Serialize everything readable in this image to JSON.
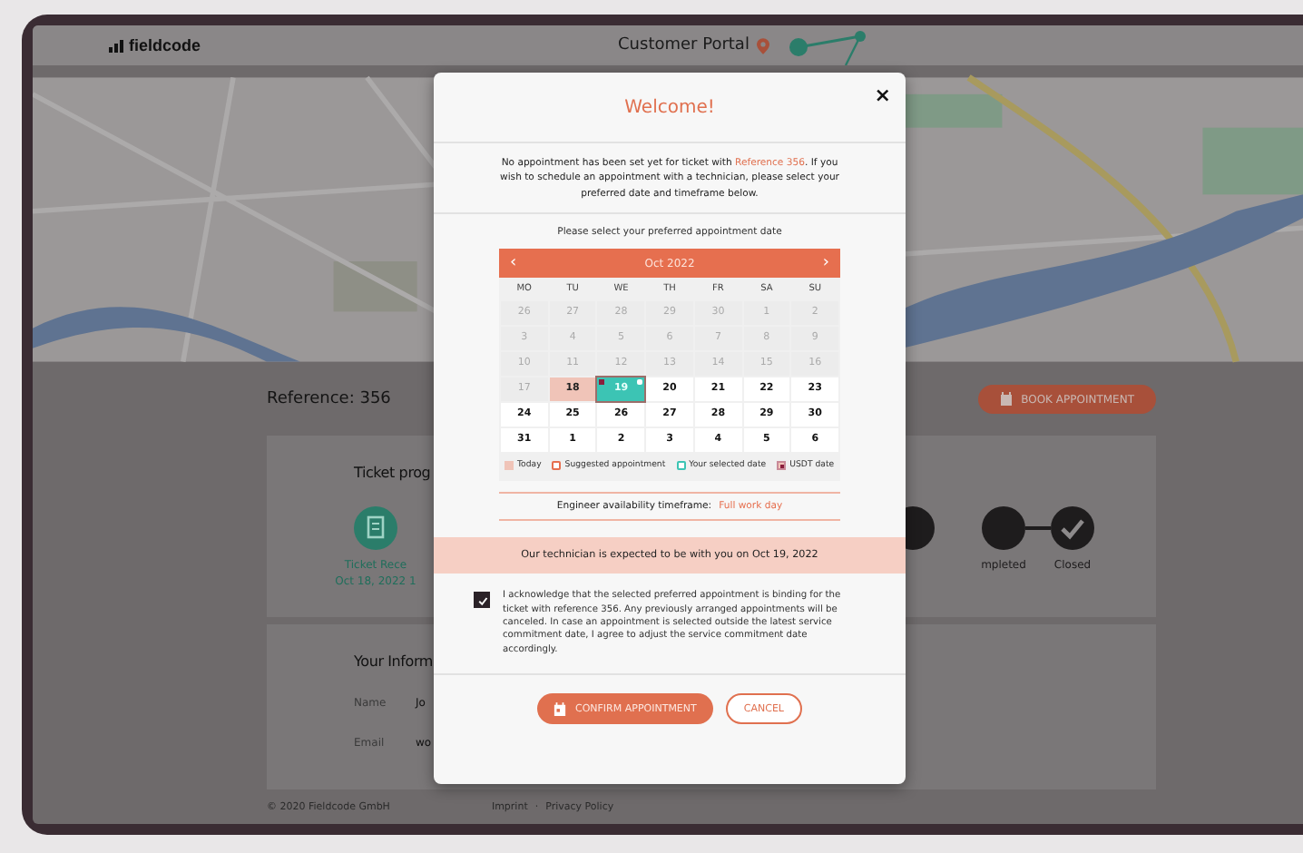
{
  "header": {
    "logo": "fieldcode",
    "title": "Customer Portal"
  },
  "reference": "Reference: 356",
  "book_button": "BOOK APPOINTMENT",
  "progress_card": {
    "title": "Ticket prog",
    "steps": [
      {
        "label": "Ticket Rece",
        "date": "Oct 18, 2022 1",
        "kind": "done"
      },
      {
        "kind": "todo"
      },
      {
        "label": "mpleted",
        "kind": "todo"
      },
      {
        "label": "Closed",
        "kind": "todo"
      }
    ]
  },
  "info_card": {
    "title": "Your Inform",
    "fields": [
      {
        "label": "Name",
        "value": "Jo"
      },
      {
        "label": "Email",
        "value": "wo"
      }
    ]
  },
  "footer": {
    "copyright": "© 2020 Fieldcode GmbH",
    "links": [
      "Imprint",
      "Privacy Policy"
    ],
    "separator": "·"
  },
  "modal": {
    "title": "Welcome!",
    "close": "×",
    "intro": {
      "before": "No appointment has been set yet for ticket with ",
      "link": "Reference 356",
      "after": ". If you wish to schedule an appointment with a technician, please select your preferred date and timeframe below."
    },
    "prompt": "Please select your preferred appointment date",
    "calendar": {
      "month": "Oct 2022",
      "prev": "‹",
      "next": "›",
      "weekdays": [
        "MO",
        "TU",
        "WE",
        "TH",
        "FR",
        "SA",
        "SU"
      ],
      "days": [
        {
          "day": "26",
          "kind": "past",
          "selected": false,
          "usdt": false,
          "suggested": false
        },
        {
          "day": "27",
          "kind": "past",
          "selected": false,
          "usdt": false,
          "suggested": false
        },
        {
          "day": "28",
          "kind": "past",
          "selected": false,
          "usdt": false,
          "suggested": false
        },
        {
          "day": "29",
          "kind": "past",
          "selected": false,
          "usdt": false,
          "suggested": false
        },
        {
          "day": "30",
          "kind": "past",
          "selected": false,
          "usdt": false,
          "suggested": false
        },
        {
          "day": "1",
          "kind": "past",
          "selected": false,
          "usdt": false,
          "suggested": false
        },
        {
          "day": "2",
          "kind": "past",
          "selected": false,
          "usdt": false,
          "suggested": false
        },
        {
          "day": "3",
          "kind": "past",
          "selected": false,
          "usdt": false,
          "suggested": false
        },
        {
          "day": "4",
          "kind": "past",
          "selected": false,
          "usdt": false,
          "suggested": false
        },
        {
          "day": "5",
          "kind": "past",
          "selected": false,
          "usdt": false,
          "suggested": false
        },
        {
          "day": "6",
          "kind": "past",
          "selected": false,
          "usdt": false,
          "suggested": false
        },
        {
          "day": "7",
          "kind": "past",
          "selected": false,
          "usdt": false,
          "suggested": false
        },
        {
          "day": "8",
          "kind": "past",
          "selected": false,
          "usdt": false,
          "suggested": false
        },
        {
          "day": "9",
          "kind": "past",
          "selected": false,
          "usdt": false,
          "suggested": false
        },
        {
          "day": "10",
          "kind": "past",
          "selected": false,
          "usdt": false,
          "suggested": false
        },
        {
          "day": "11",
          "kind": "past",
          "selected": false,
          "usdt": false,
          "suggested": false
        },
        {
          "day": "12",
          "kind": "past",
          "selected": false,
          "usdt": false,
          "suggested": false
        },
        {
          "day": "13",
          "kind": "past",
          "selected": false,
          "usdt": false,
          "suggested": false
        },
        {
          "day": "14",
          "kind": "past",
          "selected": false,
          "usdt": false,
          "suggested": false
        },
        {
          "day": "15",
          "kind": "past",
          "selected": false,
          "usdt": false,
          "suggested": false
        },
        {
          "day": "16",
          "kind": "past",
          "selected": false,
          "usdt": false,
          "suggested": false
        },
        {
          "day": "17",
          "kind": "past",
          "selected": false,
          "usdt": false,
          "suggested": false
        },
        {
          "day": "18",
          "kind": "today",
          "selected": false,
          "usdt": false,
          "suggested": false
        },
        {
          "day": "19",
          "kind": "available",
          "selected": true,
          "usdt": true,
          "suggested": true
        },
        {
          "day": "20",
          "kind": "available",
          "selected": false,
          "usdt": false,
          "suggested": false
        },
        {
          "day": "21",
          "kind": "available",
          "selected": false,
          "usdt": false,
          "suggested": false
        },
        {
          "day": "22",
          "kind": "available",
          "selected": false,
          "usdt": false,
          "suggested": false
        },
        {
          "day": "23",
          "kind": "available",
          "selected": false,
          "usdt": false,
          "suggested": false
        },
        {
          "day": "24",
          "kind": "available",
          "selected": false,
          "usdt": false,
          "suggested": false
        },
        {
          "day": "25",
          "kind": "available",
          "selected": false,
          "usdt": false,
          "suggested": false
        },
        {
          "day": "26",
          "kind": "available",
          "selected": false,
          "usdt": false,
          "suggested": false
        },
        {
          "day": "27",
          "kind": "available",
          "selected": false,
          "usdt": false,
          "suggested": false
        },
        {
          "day": "28",
          "kind": "available",
          "selected": false,
          "usdt": false,
          "suggested": false
        },
        {
          "day": "29",
          "kind": "available",
          "selected": false,
          "usdt": false,
          "suggested": false
        },
        {
          "day": "30",
          "kind": "available",
          "selected": false,
          "usdt": false,
          "suggested": false
        },
        {
          "day": "31",
          "kind": "available",
          "selected": false,
          "usdt": false,
          "suggested": false
        },
        {
          "day": "1",
          "kind": "available",
          "selected": false,
          "usdt": false,
          "suggested": false
        },
        {
          "day": "2",
          "kind": "available",
          "selected": false,
          "usdt": false,
          "suggested": false
        },
        {
          "day": "3",
          "kind": "available",
          "selected": false,
          "usdt": false,
          "suggested": false
        },
        {
          "day": "4",
          "kind": "available",
          "selected": false,
          "usdt": false,
          "suggested": false
        },
        {
          "day": "5",
          "kind": "available",
          "selected": false,
          "usdt": false,
          "suggested": false
        },
        {
          "day": "6",
          "kind": "available",
          "selected": false,
          "usdt": false,
          "suggested": false
        }
      ],
      "legend": [
        {
          "kind": "today",
          "label": "Today"
        },
        {
          "kind": "suggested",
          "label": "Suggested appointment"
        },
        {
          "kind": "selected",
          "label": "Your selected date"
        },
        {
          "kind": "usdt",
          "label": "USDT date"
        }
      ]
    },
    "timeframe": {
      "label": "Engineer availability timeframe:",
      "value": "Full work day"
    },
    "banner": "Our technician is expected to be with you on Oct 19, 2022",
    "acknowledge": {
      "checked": true,
      "text": "I acknowledge that the selected preferred appointment is binding for the ticket with reference 356. Any previously arranged appointments will be canceled. In case an appointment is selected outside the latest service commitment date, I agree to adjust the service commitment date accordingly."
    },
    "buttons": [
      {
        "kind": "primary",
        "label": "CONFIRM APPOINTMENT"
      },
      {
        "kind": "secondary",
        "label": "CANCEL"
      }
    ]
  }
}
